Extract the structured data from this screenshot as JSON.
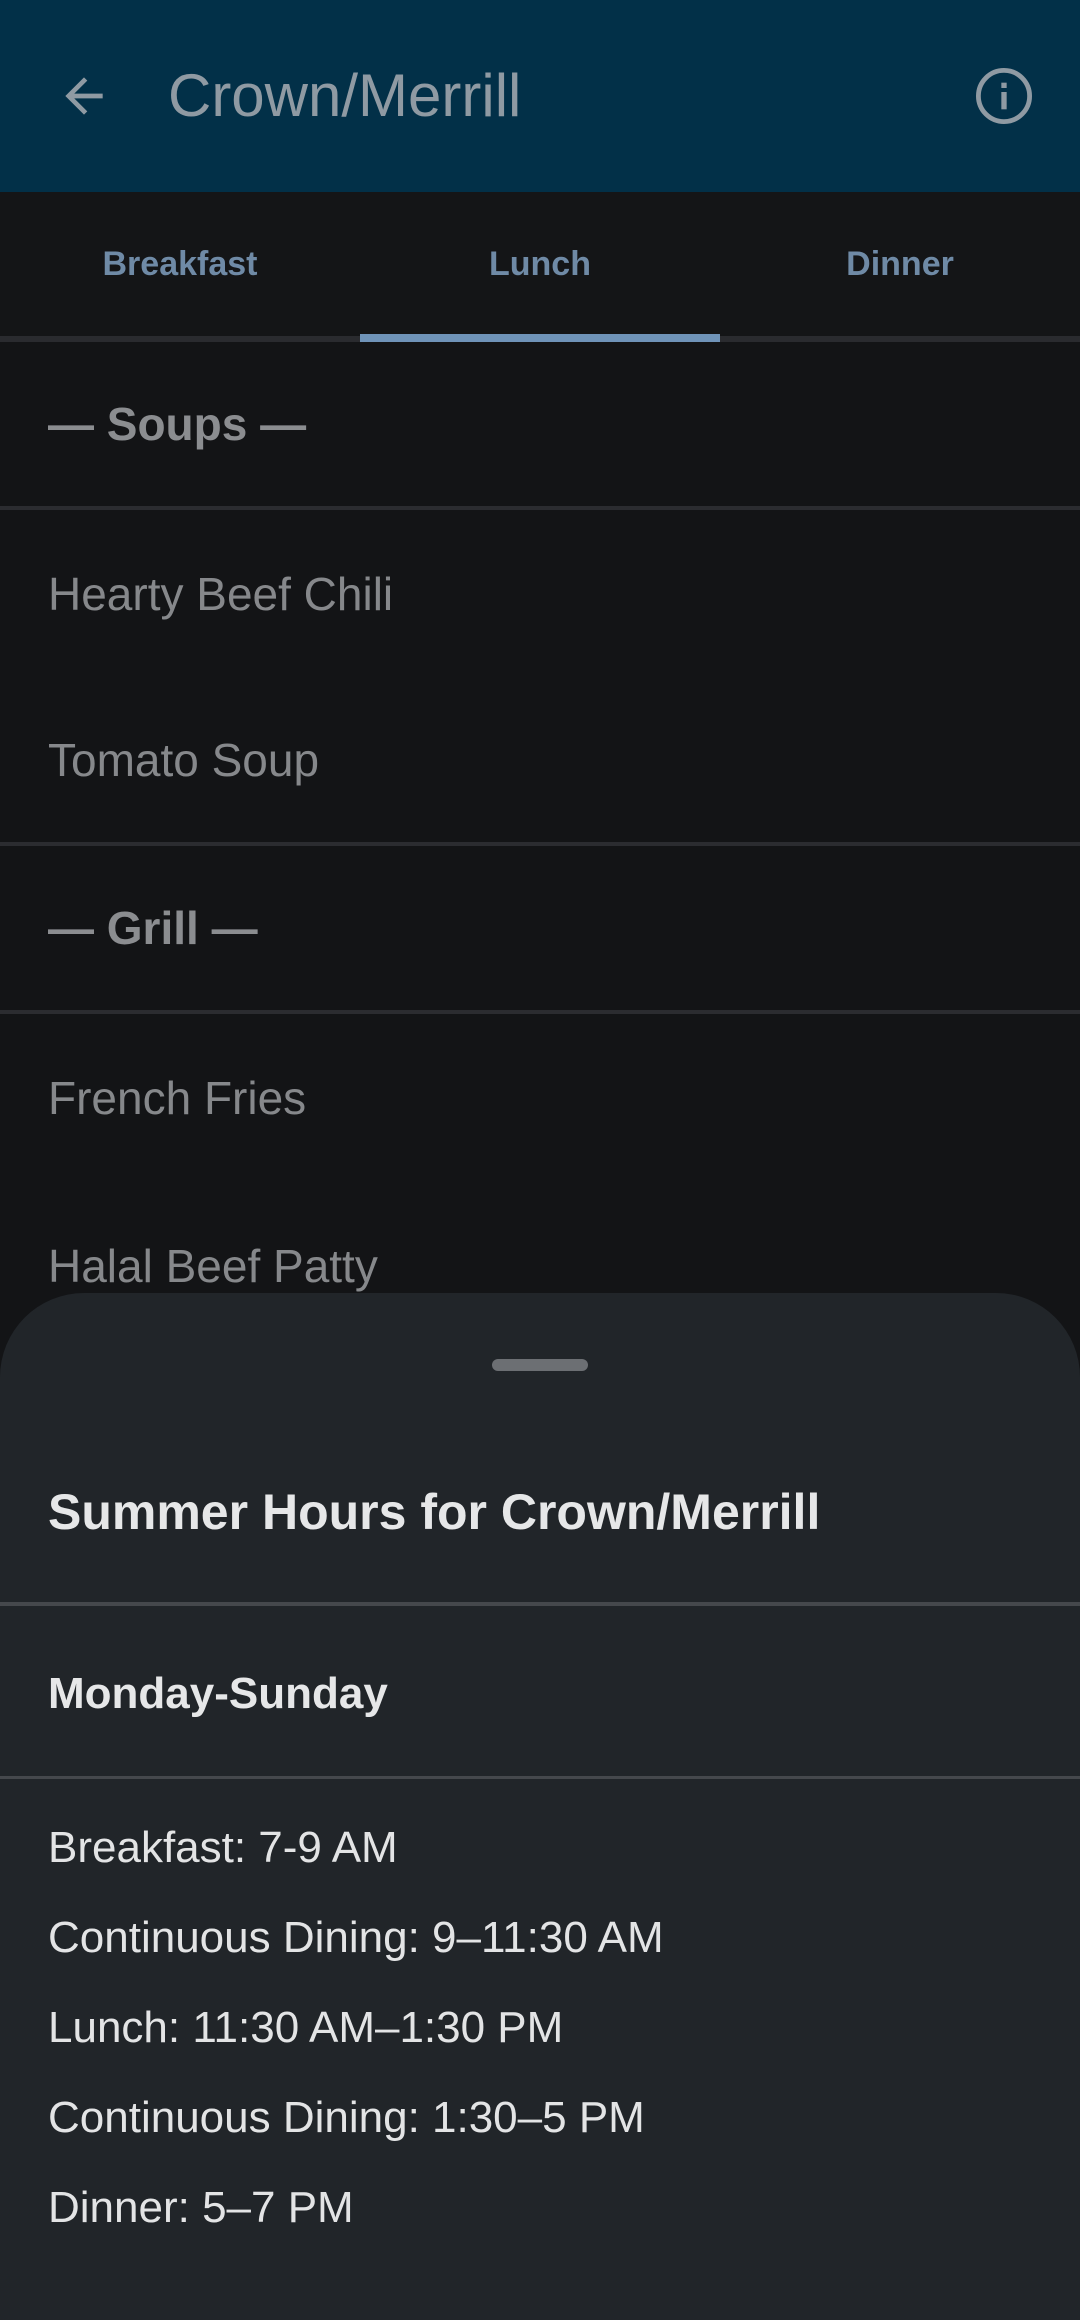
{
  "appbar": {
    "title": "Crown/Merrill",
    "back_icon": "arrow-left-icon",
    "info_icon": "info-circle-icon",
    "background": "#023048"
  },
  "tabs": [
    {
      "label": "Breakfast",
      "selected": false
    },
    {
      "label": "Lunch",
      "selected": true
    },
    {
      "label": "Dinner",
      "selected": false
    }
  ],
  "menu": {
    "groups": [
      {
        "header": "— Soups —",
        "items": [
          "Hearty Beef Chili",
          "Tomato Soup"
        ]
      },
      {
        "header": "— Grill —",
        "items": [
          "French Fries",
          "Halal Beef Patty"
        ]
      }
    ]
  },
  "sheet": {
    "title": "Summer Hours for Crown/Merrill",
    "days": "Monday-Sunday",
    "hours": [
      "Breakfast: 7-9 AM",
      "Continuous Dining: 9–11:30 AM",
      "Lunch: 11:30 AM–1:30 PM",
      "Continuous Dining: 1:30–5 PM",
      "Dinner: 5–7 PM"
    ]
  },
  "colors": {
    "accent": "#6f93b8",
    "sheet_bg": "#212529",
    "page_bg": "#131416"
  }
}
